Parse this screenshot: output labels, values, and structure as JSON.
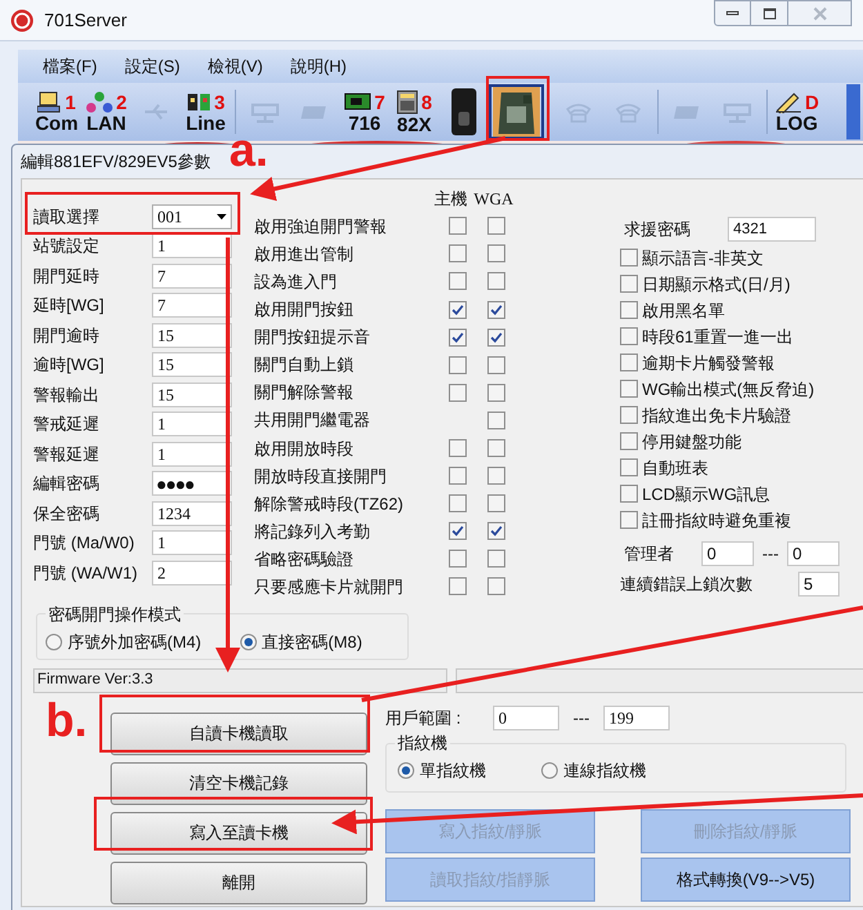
{
  "window": {
    "title": "701Server"
  },
  "menu": [
    "檔案(F)",
    "設定(S)",
    "檢視(V)",
    "說明(H)"
  ],
  "toolbar": [
    {
      "kind": "pc",
      "label": "Com",
      "num": "1",
      "disabled": false,
      "selected": false
    },
    {
      "kind": "net",
      "label": "LAN",
      "num": "2",
      "disabled": false,
      "selected": false
    },
    {
      "kind": "usb",
      "disabled": true,
      "selected": false
    },
    {
      "kind": "line",
      "label": "Line",
      "num": "3",
      "disabled": false,
      "selected": false
    },
    {
      "kind": "sep"
    },
    {
      "kind": "plug",
      "disabled": true,
      "selected": false
    },
    {
      "kind": "drive",
      "disabled": true,
      "selected": false
    },
    {
      "kind": "board",
      "label": "716",
      "num": "7",
      "disabled": false,
      "selected": false
    },
    {
      "kind": "keypad",
      "label": "82X",
      "num": "8",
      "disabled": false,
      "selected": false
    },
    {
      "kind": "finger",
      "disabled": false,
      "selected": false
    },
    {
      "kind": "reader",
      "disabled": false,
      "selected": true
    },
    {
      "kind": "sep"
    },
    {
      "kind": "phone",
      "disabled": true,
      "selected": false
    },
    {
      "kind": "phone",
      "disabled": true,
      "selected": false
    },
    {
      "kind": "sep"
    },
    {
      "kind": "drive",
      "disabled": true,
      "selected": false
    },
    {
      "kind": "plug",
      "disabled": true,
      "selected": false
    },
    {
      "kind": "sep"
    },
    {
      "kind": "log",
      "label": "LOG",
      "num": "D",
      "disabled": false,
      "selected": false
    }
  ],
  "dialog": {
    "title": "編輯881EFV/829EV5參數",
    "fields": [
      {
        "label": "讀取選擇",
        "value": "001",
        "kind": "select"
      },
      {
        "label": "站號設定",
        "value": "1",
        "kind": "text"
      },
      {
        "label": "開門延時",
        "value": "7",
        "kind": "text"
      },
      {
        "label": "延時[WG]",
        "value": "7",
        "kind": "text"
      },
      {
        "label": "開門逾時",
        "value": "15",
        "kind": "text"
      },
      {
        "label": "逾時[WG]",
        "value": "15",
        "kind": "text"
      },
      {
        "label": "警報輸出",
        "value": "15",
        "kind": "text"
      },
      {
        "label": "警戒延遲",
        "value": "1",
        "kind": "text"
      },
      {
        "label": "警報延遲",
        "value": "1",
        "kind": "text"
      },
      {
        "label": "編輯密碼",
        "value": "●●●●",
        "kind": "password"
      },
      {
        "label": "保全密碼",
        "value": "1234",
        "kind": "text"
      },
      {
        "label": "門號 (Ma/W0)",
        "value": "1",
        "kind": "text"
      },
      {
        "label": "門號 (WA/W1)",
        "value": "2",
        "kind": "text"
      }
    ],
    "option_headers": [
      "主機",
      "WGA"
    ],
    "options": [
      {
        "label": "啟用強迫開門警報",
        "main": false,
        "wga": false
      },
      {
        "label": "啟用進出管制",
        "main": false,
        "wga": false
      },
      {
        "label": "設為進入門",
        "main": false,
        "wga": false
      },
      {
        "label": "啟用開門按鈕",
        "main": true,
        "wga": true
      },
      {
        "label": "開門按鈕提示音",
        "main": true,
        "wga": true
      },
      {
        "label": "關門自動上鎖",
        "main": false,
        "wga": false
      },
      {
        "label": "關門解除警報",
        "main": false,
        "wga": false
      },
      {
        "label": "共用開門繼電器",
        "wga": false
      },
      {
        "label": "啟用開放時段",
        "main": false,
        "wga": false
      },
      {
        "label": "開放時段直接開門",
        "main": false,
        "wga": false
      },
      {
        "label": "解除警戒時段(TZ62)",
        "main": false,
        "wga": false
      },
      {
        "label": "將記錄列入考勤",
        "main": true,
        "wga": true
      },
      {
        "label": "省略密碼驗證",
        "main": false,
        "wga": false
      },
      {
        "label": "只要感應卡片就開門",
        "main": false,
        "wga": false
      }
    ],
    "help_password": {
      "label": "求援密碼",
      "value": "4321"
    },
    "settings": [
      {
        "label": "顯示語言-非英文",
        "checked": false
      },
      {
        "label": "日期顯示格式(日/月)",
        "checked": false
      },
      {
        "label": "啟用黑名單",
        "checked": false
      },
      {
        "label": "時段61重置一進一出",
        "checked": false
      },
      {
        "label": "逾期卡片觸發警報",
        "checked": false
      },
      {
        "label": "WG輸出模式(無反脅迫)",
        "checked": false
      },
      {
        "label": "指紋進出免卡片驗證",
        "checked": false
      },
      {
        "label": "停用鍵盤功能",
        "checked": false
      },
      {
        "label": "自動班表",
        "checked": false
      },
      {
        "label": "LCD顯示WG訊息",
        "checked": false
      },
      {
        "label": "註冊指紋時避免重複",
        "checked": false
      }
    ],
    "admin": {
      "label": "管理者",
      "from": "0",
      "separator": "---",
      "to": "0"
    },
    "lockout": {
      "label": "連續錯誤上鎖次數",
      "value": "5"
    },
    "password_mode": {
      "title": "密碼開門操作模式",
      "options": [
        {
          "label": "序號外加密碼(M4)",
          "selected": false
        },
        {
          "label": "直接密碼(M8)",
          "selected": true
        }
      ]
    },
    "status": "Firmware Ver:3.3",
    "user_range": {
      "label": "用戶範圍 :",
      "from": "0",
      "separator": "---",
      "to": "199"
    },
    "fingerprint": {
      "title": "指紋機",
      "options": [
        {
          "label": "單指紋機",
          "selected": true
        },
        {
          "label": "連線指紋機",
          "selected": false
        }
      ]
    },
    "left_buttons": [
      "自讀卡機讀取",
      "清空卡機記錄",
      "寫入至讀卡機",
      "離開"
    ],
    "right_buttons": [
      {
        "label": "寫入指紋/靜脈",
        "disabled": true
      },
      {
        "label": "刪除指紋/靜脈",
        "disabled": true
      },
      {
        "label": "讀取指紋/指靜脈",
        "disabled": true
      },
      {
        "label": "格式轉換(V9-->V5)",
        "disabled": false
      }
    ]
  },
  "annotations": [
    "a.",
    "b."
  ]
}
